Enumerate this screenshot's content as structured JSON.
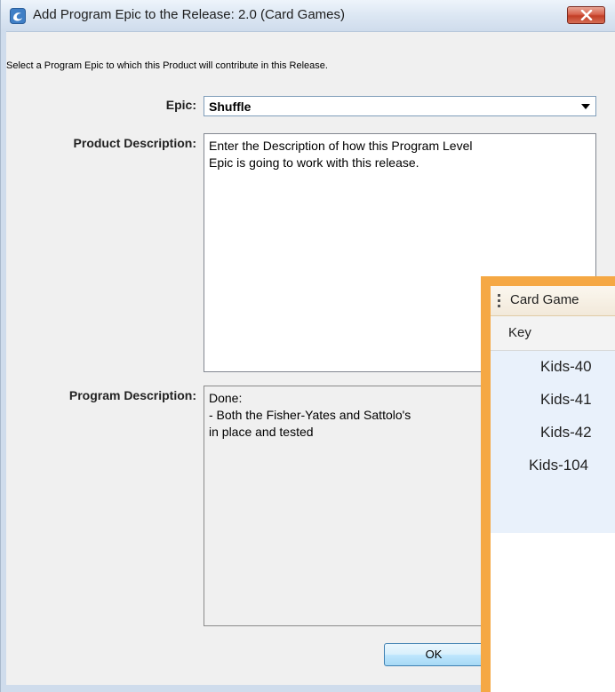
{
  "window": {
    "title": "Add Program Epic to the Release: 2.0 (Card Games)",
    "close_icon": "close-x-icon",
    "app_icon": "swirl-logo-icon"
  },
  "dialog": {
    "instruction": "Select a Program Epic to which this Product will contribute in this Release.",
    "epic_label": "Epic:",
    "epic_value": "Shuffle",
    "product_description_label": "Product Description:",
    "product_description_value": "Enter the Description of how this Program Level\nEpic is going to work with this release.",
    "program_description_label": "Program Description:",
    "program_description_value": "Done:\n- Both the Fisher-Yates and Sattolo's\nin place and tested",
    "ok_label": "OK"
  },
  "side_panel": {
    "title": "Card Game",
    "column_key": "Key",
    "rows": [
      "Kids-40",
      "Kids-41",
      "Kids-42",
      "Kids-104"
    ]
  },
  "colors": {
    "panel_accent": "#f5a844",
    "close_button": "#c23e26",
    "selection_bg": "#e9f1fb"
  }
}
